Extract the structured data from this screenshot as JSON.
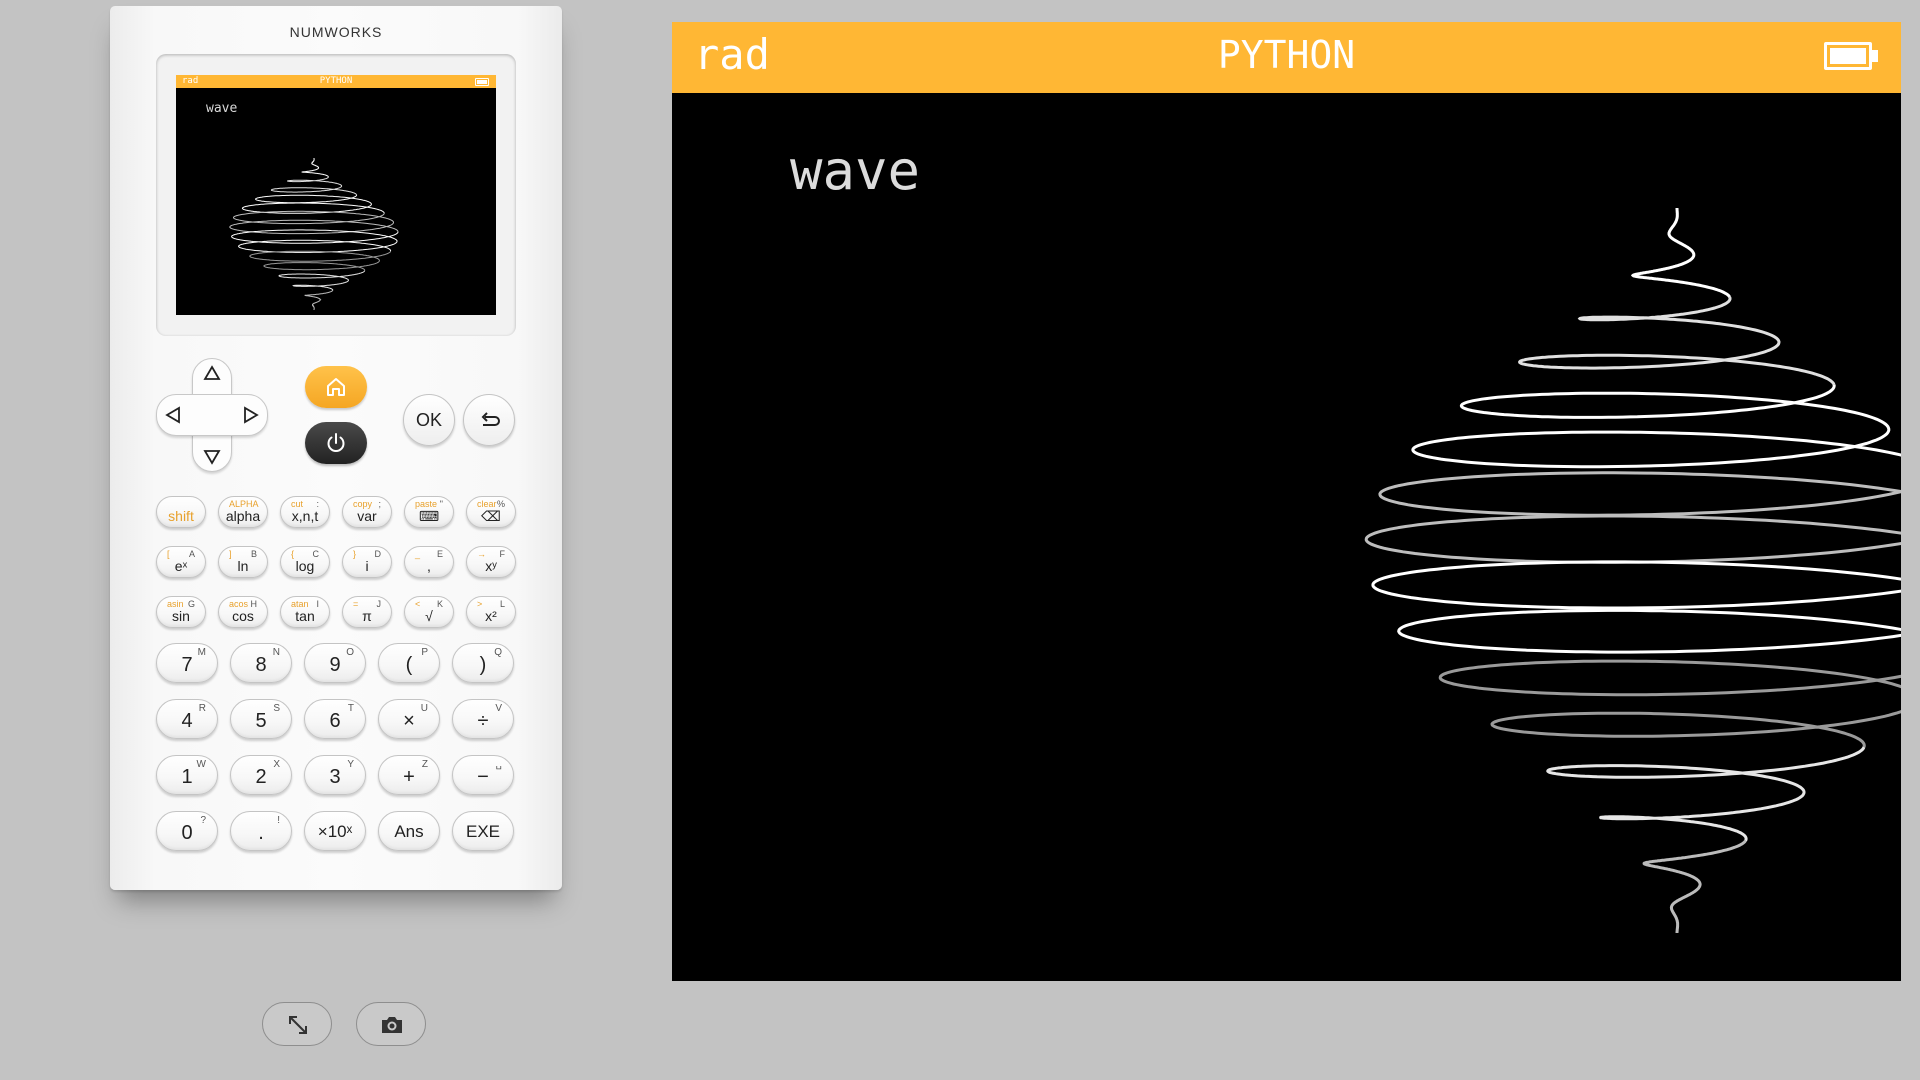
{
  "calculator": {
    "brand": "NUMWORKS",
    "screen": {
      "angle_mode": "rad",
      "app_title": "PYTHON",
      "battery": "full",
      "label": "wave"
    },
    "nav": {
      "ok_label": "OK"
    },
    "function_keys": [
      [
        {
          "main": "shift",
          "sec": "",
          "ter": ""
        },
        {
          "main": "alpha",
          "sec": "ALPHA",
          "ter": ""
        },
        {
          "main": "x,n,t",
          "sec": "cut",
          "ter": ":"
        },
        {
          "main": "var",
          "sec": "copy",
          "ter": ";"
        },
        {
          "main": "⌨",
          "sec": "paste",
          "ter": "\""
        },
        {
          "main": "⌫",
          "sec": "clear",
          "ter": "%"
        }
      ],
      [
        {
          "main": "eˣ",
          "sec": "[",
          "ter": "A"
        },
        {
          "main": "ln",
          "sec": "]",
          "ter": "B"
        },
        {
          "main": "log",
          "sec": "{",
          "ter": "C"
        },
        {
          "main": "i",
          "sec": "}",
          "ter": "D"
        },
        {
          "main": ",",
          "sec": "_",
          "ter": "E"
        },
        {
          "main": "xʸ",
          "sec": "→",
          "ter": "F"
        }
      ],
      [
        {
          "main": "sin",
          "sec": "asin",
          "ter": "G"
        },
        {
          "main": "cos",
          "sec": "acos",
          "ter": "H"
        },
        {
          "main": "tan",
          "sec": "atan",
          "ter": "I"
        },
        {
          "main": "π",
          "sec": "=",
          "ter": "J"
        },
        {
          "main": "√",
          "sec": "<",
          "ter": "K"
        },
        {
          "main": "x²",
          "sec": ">",
          "ter": "L"
        }
      ]
    ],
    "number_keys": [
      [
        {
          "main": "7",
          "ter": "M"
        },
        {
          "main": "8",
          "ter": "N"
        },
        {
          "main": "9",
          "ter": "O"
        },
        {
          "main": "(",
          "ter": "P"
        },
        {
          "main": ")",
          "ter": "Q"
        }
      ],
      [
        {
          "main": "4",
          "ter": "R"
        },
        {
          "main": "5",
          "ter": "S"
        },
        {
          "main": "6",
          "ter": "T"
        },
        {
          "main": "×",
          "ter": "U"
        },
        {
          "main": "÷",
          "ter": "V"
        }
      ],
      [
        {
          "main": "1",
          "ter": "W"
        },
        {
          "main": "2",
          "ter": "X"
        },
        {
          "main": "3",
          "ter": "Y"
        },
        {
          "main": "+",
          "ter": "Z"
        },
        {
          "main": "−",
          "ter": "␣"
        }
      ],
      [
        {
          "main": "0",
          "ter": "?"
        },
        {
          "main": ".",
          "ter": "!"
        },
        {
          "main": "×10ˣ",
          "ter": ""
        },
        {
          "main": "Ans",
          "ter": ""
        },
        {
          "main": "EXE",
          "ter": ""
        }
      ]
    ]
  },
  "toolbar": {
    "fullscreen_icon": "fullscreen-icon",
    "screenshot_icon": "camera-icon"
  },
  "display": {
    "angle_mode": "rad",
    "app_title": "PYTHON",
    "battery": "full",
    "label": "wave"
  },
  "colors": {
    "accent": "#ffb734",
    "screen_bg": "#000000",
    "page_bg": "#c3c3c3",
    "secondary_label": "#e8a12c"
  }
}
